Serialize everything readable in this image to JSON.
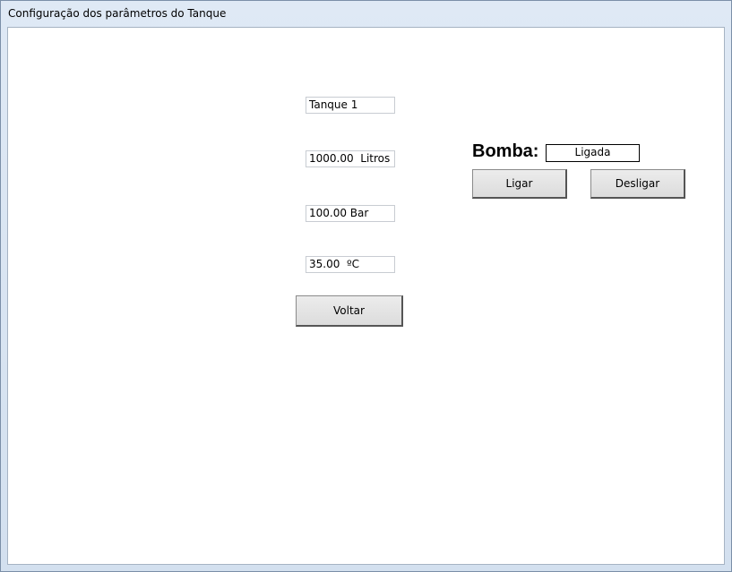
{
  "window": {
    "title": "Configuração dos parâmetros do Tanque"
  },
  "fields": {
    "tank_name": "Tanque 1",
    "volume": "1000.00  Litros",
    "pressure": "100.00 Bar",
    "temperature": "35.00  ºC"
  },
  "buttons": {
    "back_label": "Voltar",
    "on_label": "Ligar",
    "off_label": "Desligar"
  },
  "pump": {
    "label": "Bomba:",
    "status": "Ligada"
  }
}
